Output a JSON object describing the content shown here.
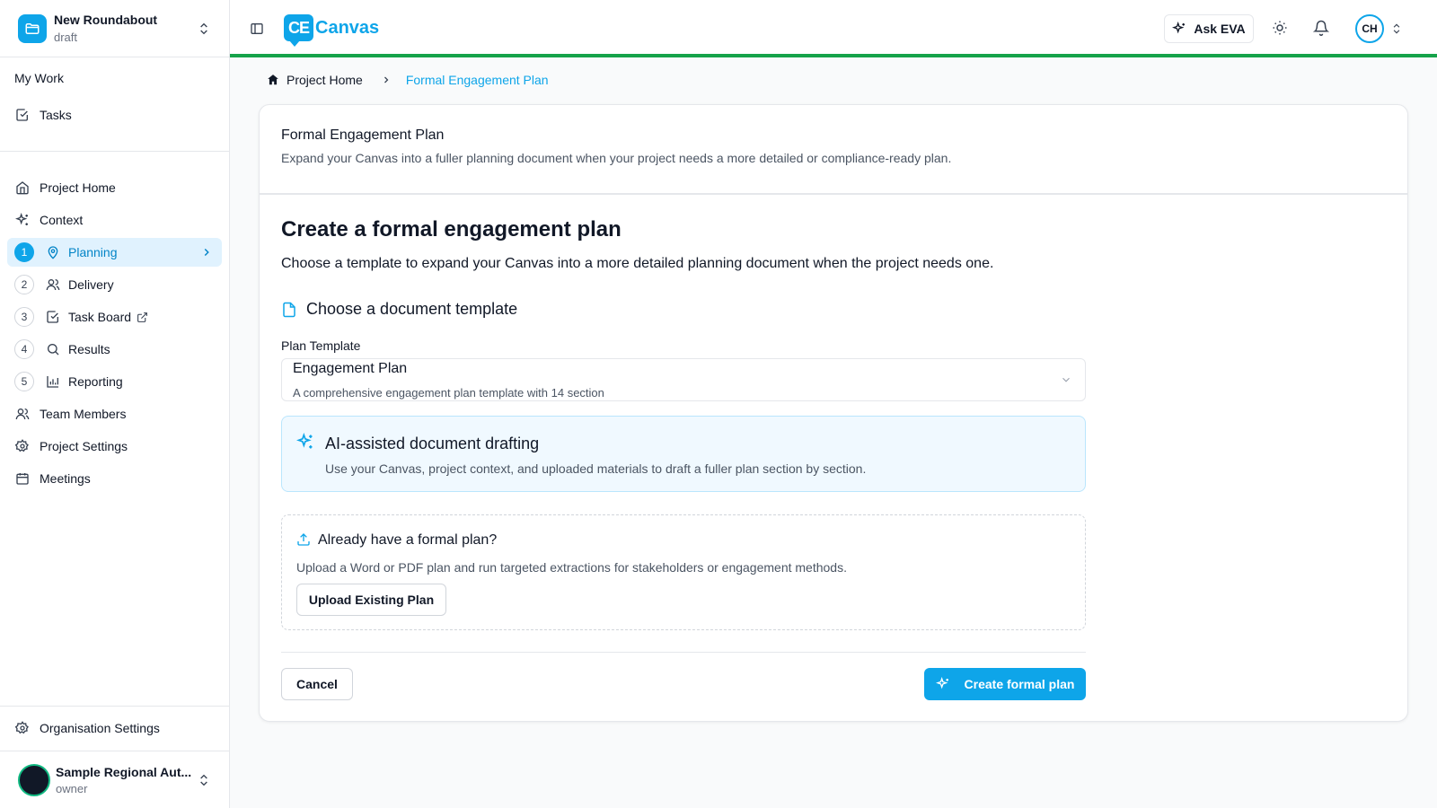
{
  "project": {
    "name": "New Roundabout",
    "status": "draft"
  },
  "sidebar": {
    "my_work_label": "My Work",
    "tasks_label": "Tasks",
    "project_home_label": "Project Home",
    "context_label": "Context",
    "steps": [
      {
        "num": "1",
        "label": "Planning"
      },
      {
        "num": "2",
        "label": "Delivery"
      },
      {
        "num": "3",
        "label": "Task Board"
      },
      {
        "num": "4",
        "label": "Results"
      },
      {
        "num": "5",
        "label": "Reporting"
      }
    ],
    "team_members_label": "Team Members",
    "project_settings_label": "Project Settings",
    "meetings_label": "Meetings",
    "org_settings_label": "Organisation Settings"
  },
  "user": {
    "org": "Sample Regional Aut...",
    "role": "owner",
    "initials": "CH"
  },
  "topbar": {
    "brand_mark": "CE",
    "brand_name": "Canvas",
    "ask_label": "Ask EVA"
  },
  "breadcrumb": {
    "home": "Project Home",
    "current": "Formal Engagement Plan"
  },
  "card": {
    "title": "Formal Engagement Plan",
    "description": "Expand your Canvas into a fuller planning document when your project needs a more detailed or compliance-ready plan.",
    "heading": "Create a formal engagement plan",
    "lead": "Choose a template to expand your Canvas into a more detailed planning document when the project needs one.",
    "template_heading": "Choose a document template",
    "field_label": "Plan Template",
    "select_title": "Engagement Plan",
    "select_sub": "A comprehensive engagement plan template with 14 section",
    "ai_title": "AI-assisted document drafting",
    "ai_desc": "Use your Canvas, project context, and uploaded materials to draft a fuller plan section by section.",
    "upload_title": "Already have a formal plan?",
    "upload_desc": "Upload a Word or PDF plan and run targeted extractions for stakeholders or engagement methods.",
    "upload_button": "Upload Existing Plan",
    "cancel_button": "Cancel",
    "create_button": "Create formal plan"
  },
  "colors": {
    "accent": "#0ea5e9",
    "active_bg": "#e0f2fe",
    "topbar_border": "#16a34a"
  }
}
